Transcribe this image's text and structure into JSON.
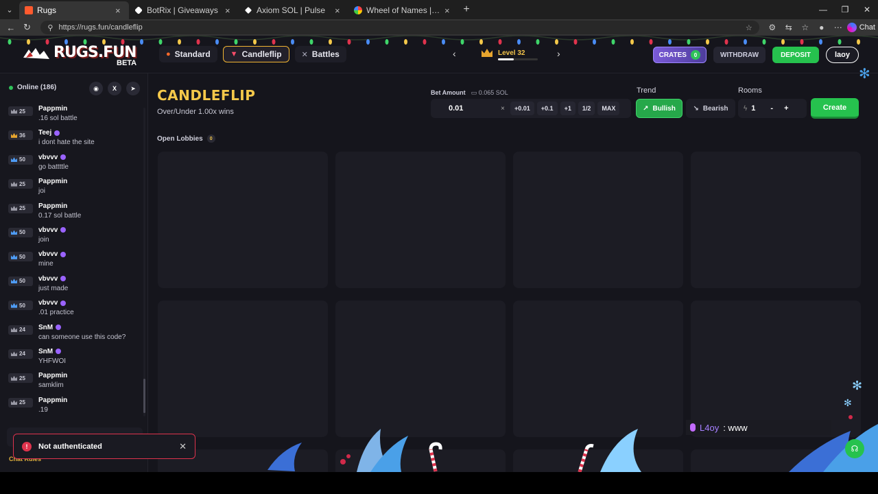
{
  "browser": {
    "tabs": [
      {
        "title": "Rugs",
        "active": true
      },
      {
        "title": "BotRix | Giveaways",
        "active": false
      },
      {
        "title": "Axiom SOL | Pulse",
        "active": false
      },
      {
        "title": "Wheel of Names | Random name",
        "active": false
      }
    ],
    "url": "https://rugs.fun/candleflip",
    "chat_label": "Chat"
  },
  "header": {
    "logo_text": "RUGS.FUN",
    "logo_badge": "BETA",
    "nav": [
      {
        "label": "Standard",
        "icon": "flame-icon",
        "active": false
      },
      {
        "label": "Candleflip",
        "icon": "candle-icon",
        "active": true
      },
      {
        "label": "Battles",
        "icon": "swords-icon",
        "active": false
      }
    ],
    "level_label": "Level 32",
    "level_progress": 0.4,
    "crates_label": "CRATES",
    "crates_count": "0",
    "withdraw_label": "WITHDRAW",
    "deposit_label": "DEPOSIT",
    "username": "laoy"
  },
  "sidebar": {
    "online_label": "Online (186)",
    "chat": [
      {
        "level": "25",
        "name": "Pappmin",
        "text": ".16 sol battle",
        "verified": false,
        "tier": "gray"
      },
      {
        "level": "36",
        "name": "Teej",
        "text": "i dont hate the site",
        "verified": true,
        "tier": "gold"
      },
      {
        "level": "50",
        "name": "vbvvv",
        "text": "go battttle",
        "verified": true,
        "tier": "blue"
      },
      {
        "level": "25",
        "name": "Pappmin",
        "text": "joi",
        "verified": false,
        "tier": "gray"
      },
      {
        "level": "25",
        "name": "Pappmin",
        "text": "0.17 sol battle",
        "verified": false,
        "tier": "gray"
      },
      {
        "level": "50",
        "name": "vbvvv",
        "text": "join",
        "verified": true,
        "tier": "blue"
      },
      {
        "level": "50",
        "name": "vbvvv",
        "text": "mine",
        "verified": true,
        "tier": "blue"
      },
      {
        "level": "50",
        "name": "vbvvv",
        "text": "just made",
        "verified": true,
        "tier": "blue"
      },
      {
        "level": "50",
        "name": "vbvvv",
        "text": ".01 practice",
        "verified": true,
        "tier": "blue"
      },
      {
        "level": "24",
        "name": "SnM",
        "text": "can someone use this code?",
        "verified": true,
        "tier": "gray"
      },
      {
        "level": "24",
        "name": "SnM",
        "text": "YHFWOI",
        "verified": true,
        "tier": "gray"
      },
      {
        "level": "25",
        "name": "Pappmin",
        "text": "samklim",
        "verified": false,
        "tier": "gray"
      },
      {
        "level": "25",
        "name": "Pappmin",
        "text": ".19",
        "verified": false,
        "tier": "gray"
      }
    ],
    "chat_rules_label": "Chat Rules"
  },
  "main": {
    "title": "CANDLEFLIP",
    "subtitle": "Over/Under 1.00x wins",
    "bet_label": "Bet Amount",
    "bet_balance": "0.065 SOL",
    "bet_value": "0.01",
    "chips": [
      "+0.01",
      "+0.1",
      "+1",
      "1/2",
      "MAX"
    ],
    "trend_label": "Trend",
    "bullish_label": "Bullish",
    "bearish_label": "Bearish",
    "rooms_label": "Rooms",
    "rooms_value": "1",
    "rooms_minus": "-",
    "rooms_plus": "+",
    "create_label": "Create",
    "open_lobbies_label": "Open Lobbies",
    "open_lobbies_count": "0"
  },
  "toast": {
    "message": "Not authenticated"
  },
  "overlay": {
    "user": "L4oy",
    "text": ": www"
  },
  "colors": {
    "accent_gold": "#f4c84a",
    "green": "#26c24e",
    "error": "#e0334d",
    "bg": "#15151c"
  }
}
